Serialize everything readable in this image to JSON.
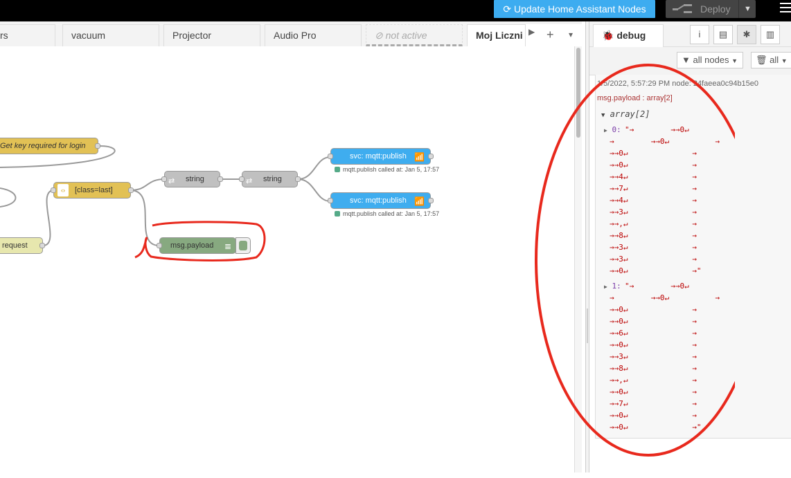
{
  "header": {
    "update_button": "Update Home Assistant Nodes",
    "deploy_button": "Deploy"
  },
  "tabs": [
    {
      "label": "rs"
    },
    {
      "label": "vacuum"
    },
    {
      "label": "Projector"
    },
    {
      "label": "Audio Pro"
    },
    {
      "label": "not active"
    },
    {
      "label": "Moj Liczni"
    }
  ],
  "tab_controls": {
    "add": "+",
    "menu": "▾"
  },
  "flow": {
    "nodes": {
      "get_key": "Get key required for login",
      "class_last": "[class=last]",
      "string1": "string",
      "string2": "string",
      "svc1": "svc: mqtt:publish",
      "svc2": "svc: mqtt:publish",
      "request": "request",
      "debug": "msg.payload"
    },
    "status1": "mqtt.publish called at: Jan 5, 17:57",
    "status2": "mqtt.publish called at: Jan 5, 17:57"
  },
  "sidebar": {
    "tab": "debug",
    "filter_nodes": "all nodes",
    "filter_clear": "all",
    "message": {
      "meta": "1/5/2022, 5:57:29 PM   node: 24faeea0c94b15e0",
      "topic": "msg.payload : array[2]",
      "array_label": "array[2]",
      "item0_key": "0:",
      "item1_key": "1:",
      "item0_lines": [
        "\"→        →→0↵",
        "→        →→0↵          →",
        "→→0↵              →",
        "→→0↵              →",
        "→→4↵              →",
        "→→7↵              →",
        "→→4↵              →",
        "→→3↵              →",
        "→→,↵              →",
        "→→8↵              →",
        "→→3↵              →",
        "→→3↵              →",
        "→→0↵              →\""
      ],
      "item1_lines": [
        "\"→        →→0↵",
        "→        →→0↵          →",
        "→→0↵              →",
        "→→0↵              →",
        "→→6↵              →",
        "→→0↵              →",
        "→→3↵              →",
        "→→8↵              →",
        "→→,↵              →",
        "→→0↵              →",
        "→→7↵              →",
        "→→0↵              →",
        "→→0↵              →\""
      ]
    }
  },
  "colors": {
    "accent": "#3dacf0",
    "annotation": "#e8291d",
    "function_node": "#e2c155",
    "change_node": "#c0c0c0",
    "mqtt_node": "#3fadef",
    "debug_node": "#87a980",
    "http_node": "#e7e7ae"
  }
}
